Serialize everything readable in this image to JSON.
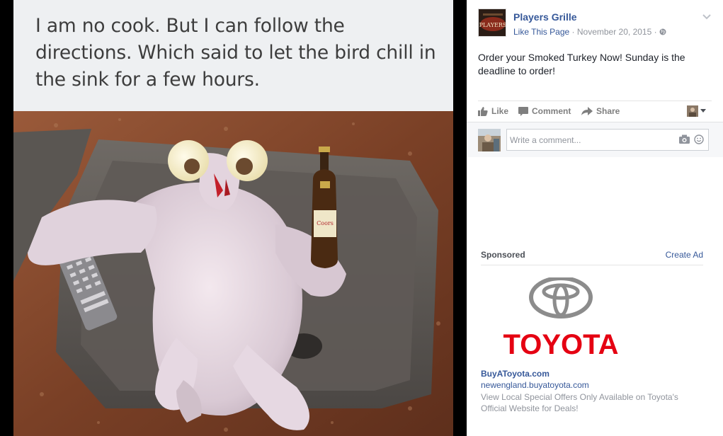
{
  "photo": {
    "caption": "I am no cook. But I can follow the directions. Which said to let the bird chill in the sink for a few hours.",
    "bottle_label": "Coors"
  },
  "post": {
    "page_name": "Players Grille",
    "page_logo_text": "PLAYERS",
    "like_page": "Like This Page",
    "date": "November 20, 2015",
    "separator": "·",
    "text": "Order your Smoked Turkey Now! Sunday is the deadline to order!",
    "actions": {
      "like": "Like",
      "comment": "Comment",
      "share": "Share"
    },
    "comment_placeholder": "Write a comment..."
  },
  "sidebar": {
    "sponsored_label": "Sponsored",
    "create_ad": "Create Ad",
    "ad": {
      "brand_wordmark": "TOYOTA",
      "title": "BuyAToyota.com",
      "domain": "newengland.buyatoyota.com",
      "description": "View Local Special Offers Only Available on Toyota's Official Website for Deals!"
    }
  },
  "colors": {
    "link": "#365899",
    "muted": "#90949c",
    "toyota_red": "#e50012",
    "background": "#000000"
  }
}
